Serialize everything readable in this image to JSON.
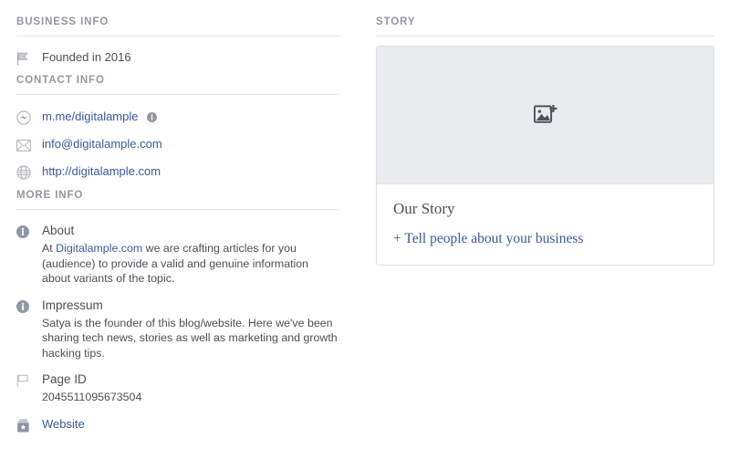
{
  "left_column": {
    "business_info": {
      "header": "BUSINESS INFO",
      "items": [
        {
          "icon": "flag-icon",
          "text": "Founded in 2016"
        }
      ]
    },
    "contact_info": {
      "header": "CONTACT INFO",
      "items": [
        {
          "icon": "messenger-icon",
          "text": "m.me/digitalample",
          "badge": "info-icon"
        },
        {
          "icon": "envelope-icon",
          "text": "info@digitalample.com"
        },
        {
          "icon": "globe-icon",
          "text": "http://digitalample.com"
        }
      ]
    },
    "more_info": {
      "header": "MORE INFO",
      "about": {
        "icon": "info-icon",
        "title": "About",
        "body_prefix": "At ",
        "body_link": "Digitalample.com",
        "body_rest": " we are crafting articles for you (audience) to provide a valid and genuine information about variants of the topic."
      },
      "impressum": {
        "icon": "info-icon",
        "title": "Impressum",
        "body": "Satya is the founder of this blog/website. Here we've been sharing tech news, stories as well as marketing and growth hacking tips."
      },
      "page_id": {
        "icon": "flag-outline-icon",
        "title": "Page ID",
        "value": "2045511095673504"
      },
      "website": {
        "icon": "app-store-icon",
        "label": "Website"
      }
    }
  },
  "right_column": {
    "story": {
      "header": "STORY",
      "cover_icon": "add-photo-icon",
      "title": "Our Story",
      "cta": "+ Tell people about your business"
    }
  },
  "colors": {
    "link": "#3b5998",
    "header_text": "#9197a3",
    "body_text": "#4b4f56",
    "divider": "#e3e4e8",
    "cover_bg": "#e9ebee",
    "card_border": "#dddfe2",
    "icon_grey": "#8d949e"
  }
}
